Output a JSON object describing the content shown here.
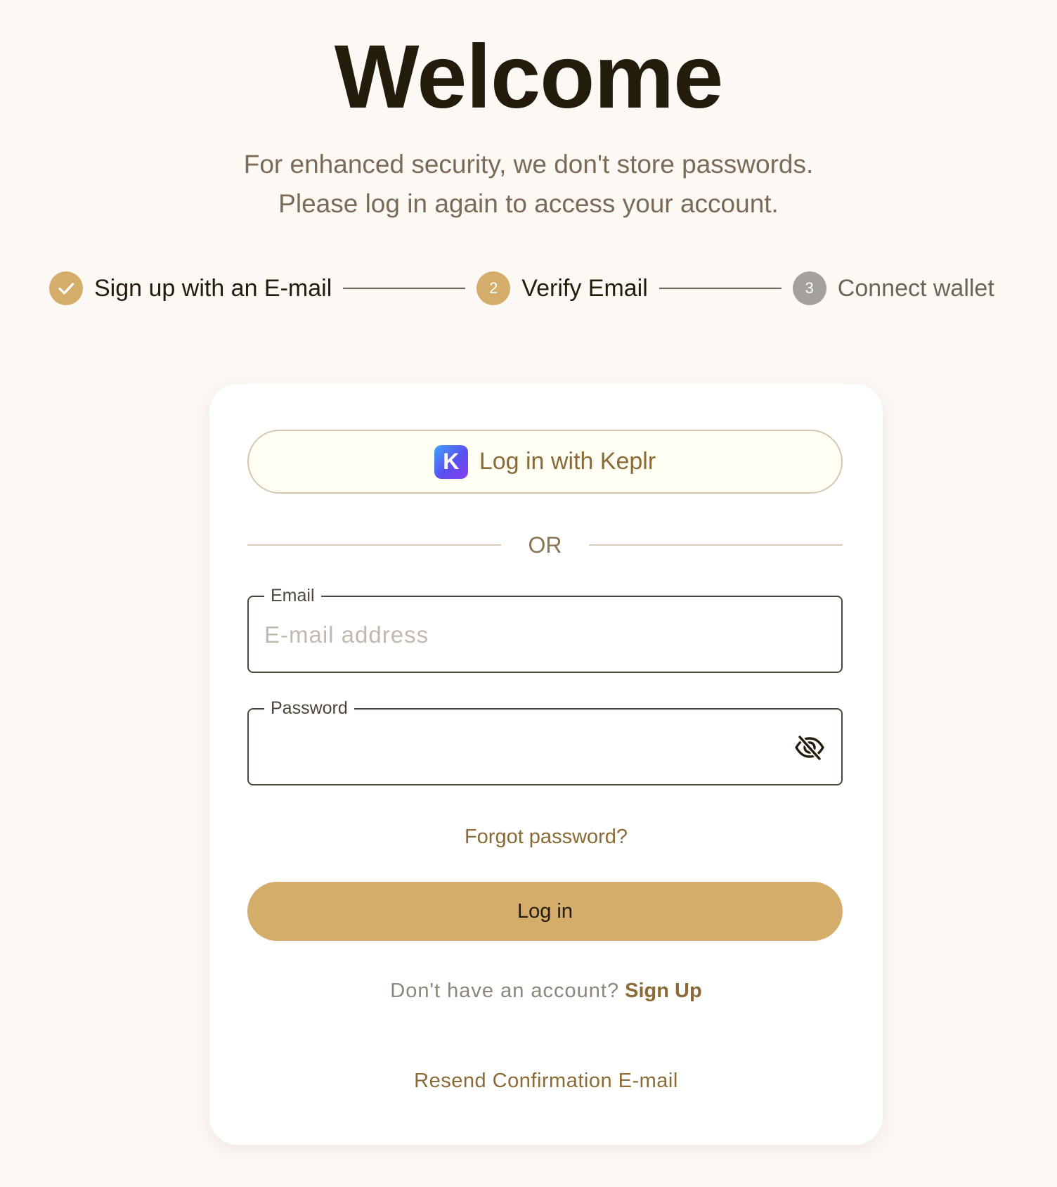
{
  "page": {
    "title": "Welcome",
    "subtitle_line1": "For enhanced security, we don't store passwords.",
    "subtitle_line2": "Please log in again to access your account."
  },
  "stepper": {
    "steps": [
      {
        "label": "Sign up with an E-mail",
        "state": "done",
        "marker": ""
      },
      {
        "label": "Verify Email",
        "state": "active",
        "marker": "2"
      },
      {
        "label": "Connect wallet",
        "state": "pending",
        "marker": "3"
      }
    ]
  },
  "login_card": {
    "keplr_button_label": "Log in with Keplr",
    "keplr_icon_letter": "K",
    "divider_text": "OR",
    "email_field": {
      "label": "Email",
      "placeholder": "E-mail address",
      "value": ""
    },
    "password_field": {
      "label": "Password",
      "value": ""
    },
    "forgot_password": "Forgot password?",
    "login_button": "Log in",
    "no_account_text": "Don't have an account?",
    "sign_up_link": "Sign Up",
    "resend_link": "Resend Confirmation E-mail"
  },
  "colors": {
    "background": "#fcf8f4",
    "accent_gold": "#d4ad6a",
    "link_brown": "#8a6a35",
    "pending_gray": "#a4a09c"
  },
  "icons": {
    "step_done": "checkmark-icon",
    "keplr": "keplr-logo-icon",
    "password_toggle": "eye-slash-icon"
  }
}
